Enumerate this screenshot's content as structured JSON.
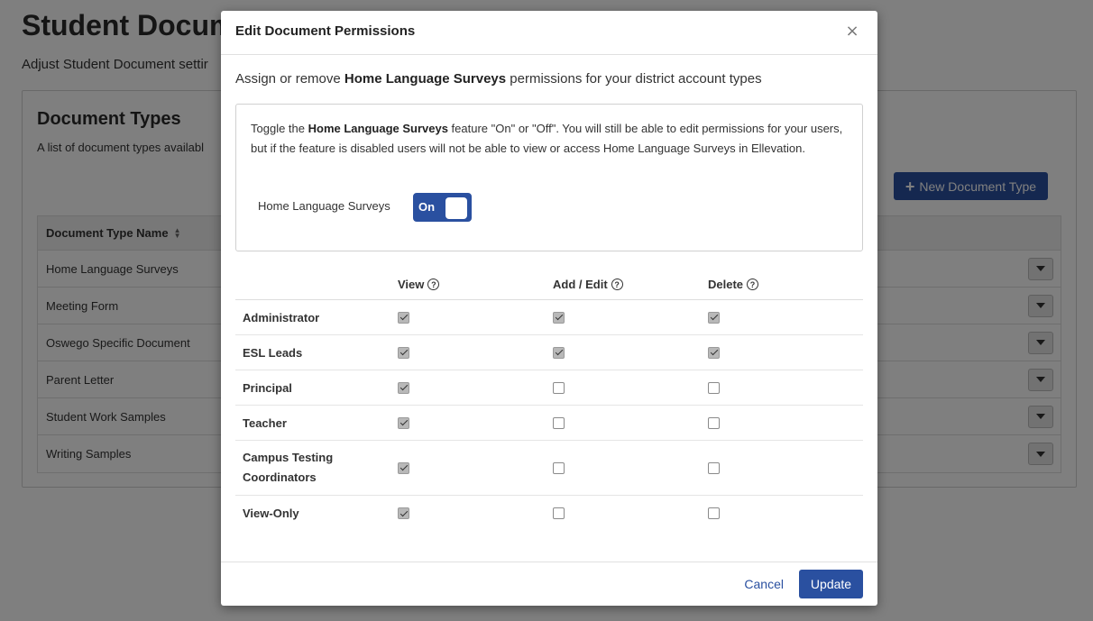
{
  "page": {
    "title": "Student Docum",
    "subtitle": "Adjust Student Document settir",
    "panel_title": "Document Types",
    "panel_desc": "A list of document types availabl",
    "new_button_label": "New Document Type",
    "table_header": "Document Type Name",
    "document_types": [
      "Home Language Surveys",
      "Meeting Form",
      "Oswego Specific Document",
      "Parent Letter",
      "Student Work Samples",
      "Writing Samples"
    ]
  },
  "modal": {
    "title": "Edit Document Permissions",
    "close_glyph": "×",
    "intro_before": "Assign or remove ",
    "intro_bold": "Home Language Surveys",
    "intro_after": " permissions for your district account types",
    "toggle_desc_before": "Toggle the ",
    "toggle_desc_bold": "Home Language Surveys",
    "toggle_desc_after": " feature \"On\" or \"Off\". You will still be able to edit permissions for your users, but if the feature is disabled users will not be able to view or access Home Language Surveys in Ellevation.",
    "toggle_label": "Home Language Surveys",
    "toggle_state": "On",
    "columns": [
      "View",
      "Add / Edit",
      "Delete"
    ],
    "help_glyph": "?",
    "roles": [
      {
        "name": "Administrator",
        "view": true,
        "edit": true,
        "delete": true
      },
      {
        "name": "ESL Leads",
        "view": true,
        "edit": true,
        "delete": true
      },
      {
        "name": "Principal",
        "view": true,
        "edit": false,
        "delete": false
      },
      {
        "name": "Teacher",
        "view": true,
        "edit": false,
        "delete": false
      },
      {
        "name": "Campus Testing Coordinators",
        "view": true,
        "edit": false,
        "delete": false
      },
      {
        "name": "View-Only",
        "view": true,
        "edit": false,
        "delete": false
      }
    ],
    "cancel_label": "Cancel",
    "update_label": "Update"
  },
  "colors": {
    "primary": "#2a50a0",
    "overlay": "rgba(0,0,0,0.5)"
  }
}
